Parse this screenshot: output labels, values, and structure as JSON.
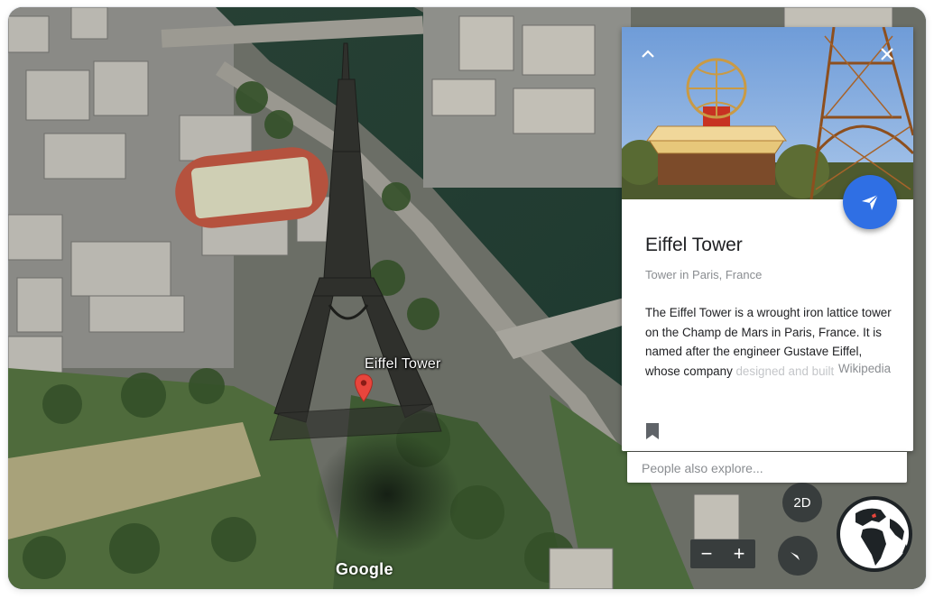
{
  "map": {
    "place_label": "Eiffel Tower",
    "attribution": "Google"
  },
  "card": {
    "title": "Eiffel Tower",
    "subtitle": "Tower in Paris, France",
    "description": "The Eiffel Tower is a wrought iron lattice tower on the Champ de Mars in Paris, France. It is named after the engineer Gustave Eiffel, whose company",
    "description_fade": " designed and built the tower.",
    "source": "Wikipedia",
    "people_also_explore": "People also explore..."
  },
  "controls": {
    "mode_toggle": "2D",
    "zoom_out": "−",
    "zoom_in": "+"
  },
  "icons": {
    "collapse": "chevron-up-icon",
    "close": "close-icon",
    "directions": "send-icon",
    "bookmark": "bookmark-icon",
    "compass": "compass-icon",
    "globe": "globe-icon",
    "pin": "map-pin-icon"
  },
  "colors": {
    "accent_blue": "#2f6fe4",
    "pin_red": "#e8453c",
    "control_bg": "#2d3234"
  }
}
